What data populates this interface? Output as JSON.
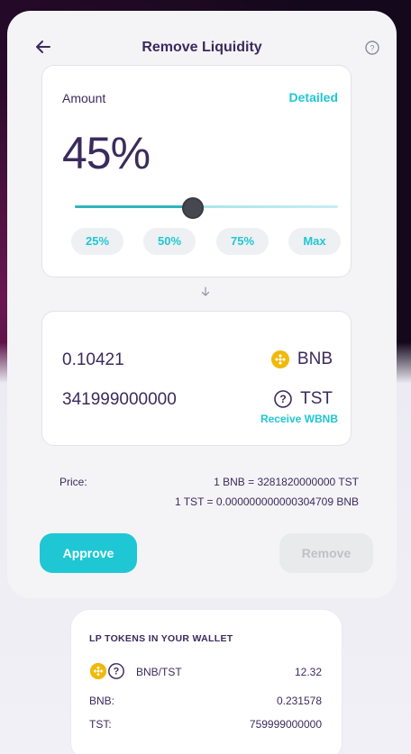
{
  "header": {
    "title": "Remove Liquidity",
    "back_icon": "arrow-left-icon",
    "help_icon": "question-circle-icon"
  },
  "amount": {
    "label": "Amount",
    "detailed_label": "Detailed",
    "percent_text": "45%",
    "value": 0.45,
    "quick_buttons": [
      "25%",
      "50%",
      "75%",
      "Max"
    ]
  },
  "output": {
    "rows": [
      {
        "amount": "0.10421",
        "symbol": "BNB",
        "icon": "bnb-coin-icon"
      },
      {
        "amount": "341999000000",
        "symbol": "TST",
        "icon": "unknown-token-icon"
      }
    ],
    "receive_label": "Receive WBNB"
  },
  "price": {
    "label": "Price:",
    "line1": "1 BNB = 3281820000000 TST",
    "line2": "1 TST = 0.000000000000304709 BNB"
  },
  "actions": {
    "approve_label": "Approve",
    "remove_label": "Remove"
  },
  "lp_wallet": {
    "title": "LP TOKENS IN YOUR WALLET",
    "pair": "BNB/TST",
    "pair_amount": "12.32",
    "rows": [
      {
        "label": "BNB:",
        "value": "0.231578"
      },
      {
        "label": "TST:",
        "value": "759999000000"
      }
    ]
  },
  "colors": {
    "accent": "#1fc7d4",
    "text": "#3b2b5c",
    "bnb": "#f0b90b"
  }
}
